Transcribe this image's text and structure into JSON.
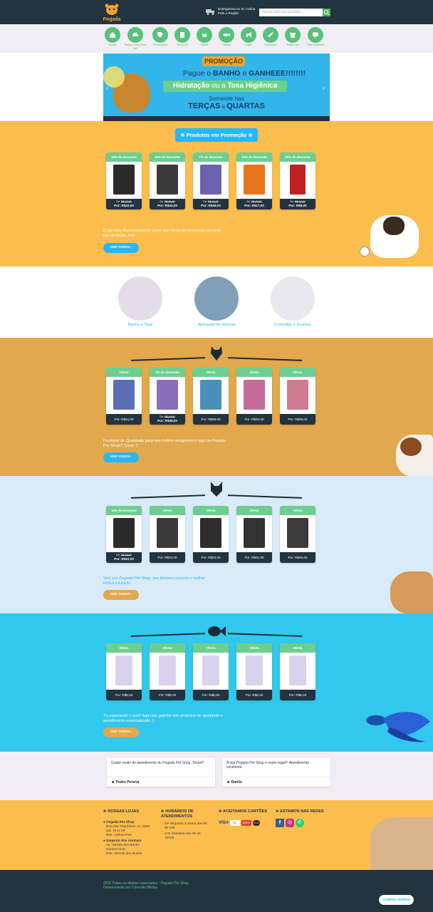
{
  "header": {
    "logo_text": "Pegada",
    "delivery_text": "Entregamos no St. Celina Park e Região",
    "search_placeholder": "buscar pelo seu produto...",
    "search_icon": "search-icon"
  },
  "nav": {
    "items": [
      {
        "label": "Home",
        "icon": "home-icon"
      },
      {
        "label": "Busca Leva sem pet",
        "icon": "car-icon"
      },
      {
        "label": "Promoções",
        "icon": "tag-icon"
      },
      {
        "label": "Serviços",
        "icon": "services-icon"
      },
      {
        "label": "Gatos",
        "icon": "cat-icon"
      },
      {
        "label": "Peixes",
        "icon": "fish-icon"
      },
      {
        "label": "Cães",
        "icon": "dog-icon"
      },
      {
        "label": "Pássaros",
        "icon": "bird-icon"
      },
      {
        "label": "Sobre nós",
        "icon": "store-icon"
      },
      {
        "label": "Fale Conosco",
        "icon": "chat-icon"
      }
    ]
  },
  "banner": {
    "badge": "PROMOÇÃO",
    "line1a": "Pague o ",
    "line1b": "BANHO",
    "line1c": " e ",
    "line1d": "GANHEEE!!!!!!!!",
    "line2a": "Hidratação",
    "line2b": " ou a ",
    "line2c": "Tosa Higiênica",
    "line3": "Somente nas",
    "line4a": "TERÇAS",
    "line4b": " e ",
    "line4c": "QUARTAS"
  },
  "promo": {
    "title": "Produtos em Promoção",
    "description": "O gambito Busca buscoOh Corre que há tendo promoção pra todo tipo de bicho, rsrs",
    "button": "VER TODOS",
    "products": [
      {
        "badge": "19% de desconto",
        "old": "De: R$ 27,00",
        "price": "Por: R$22,00",
        "color": "#2b2b2b"
      },
      {
        "badge": "12% de desconto",
        "old": "De: R$ 50,00",
        "price": "Por: R$44,00",
        "color": "#3a3a3a"
      },
      {
        "badge": "7% de desconto",
        "old": "De: R$ 42,00",
        "price": "Por: R$39,00",
        "color": "#6b62b0"
      },
      {
        "badge": "15% de desconto",
        "old": "De: R$ 20,00",
        "price": "Por: R$17,00",
        "color": "#e8741e"
      },
      {
        "badge": "10% de desconto",
        "old": "De: R$ 10,00",
        "price": "Por: R$9,00",
        "color": "#c02020"
      }
    ]
  },
  "services": [
    {
      "label": "Banho e Tosa"
    },
    {
      "label": "Aplicação de Vacinas"
    },
    {
      "label": "Consultas e Exames"
    }
  ],
  "dogs": {
    "description": "Produtos de Qualidade para seu melhor amiguinho é aqui na Pegada Pet Shop!!! Corre :)",
    "button": "VER TODOS",
    "products": [
      {
        "badge": "Oferta",
        "old": "",
        "price": "Por: R$41,00",
        "color": "#5b6fb5"
      },
      {
        "badge": "7% de desconto",
        "old": "De: R$ 42,00",
        "price": "Por: R$39,00",
        "color": "#8a6fb8"
      },
      {
        "badge": "Oferta",
        "old": "",
        "price": "Por: R$39,00",
        "color": "#4a8fb8"
      },
      {
        "badge": "Oferta",
        "old": "",
        "price": "Por: R$40,00",
        "color": "#c56b9a"
      },
      {
        "badge": "Oferta",
        "old": "",
        "price": "Por: R$39,00",
        "color": "#d07a8f"
      }
    ]
  },
  "cats": {
    "description": "Vem pro Pegada Pet Shop, seu bichano merece o melhor MIAUUUUUUU",
    "button": "VER TODOS",
    "products": [
      {
        "badge": "12% de desconto",
        "old": "De: R$ 25,00",
        "price": "Por: R$22,00",
        "color": "#2b2b2b"
      },
      {
        "badge": "Oferta",
        "old": "",
        "price": "Por: R$22,00",
        "color": "#3a3a3a"
      },
      {
        "badge": "Oferta",
        "old": "",
        "price": "Por: R$20,00",
        "color": "#2d2d2d"
      },
      {
        "badge": "Oferta",
        "old": "",
        "price": "Por: R$21,00",
        "color": "#333333"
      },
      {
        "badge": "Oferta",
        "old": "",
        "price": "Por: R$45,00",
        "color": "#3b3b3b"
      }
    ]
  },
  "fish": {
    "description": "Tá esperando o quê? Aqui seu galinho tem produtos de qualidade e atendimento especializado ;)",
    "button": "VER TODOS",
    "products": [
      {
        "badge": "Oferta",
        "old": "",
        "price": "Por: R$6,00",
        "color": "#e0dcf0"
      },
      {
        "badge": "Oferta",
        "old": "",
        "price": "Por: R$6,00",
        "color": "#e0dcf0"
      },
      {
        "badge": "Oferta",
        "old": "",
        "price": "Por: R$6,00",
        "color": "#e0dcf0"
      },
      {
        "badge": "Oferta",
        "old": "",
        "price": "Por: R$6,00",
        "color": "#e0dcf0"
      },
      {
        "badge": "Oferta",
        "old": "",
        "price": "Por: R$6,00",
        "color": "#e0dcf0"
      }
    ]
  },
  "testimonials": [
    {
      "text": "Gostei muito do atendimento do Pegada Pet Shop. Show!!!",
      "author": "Pedro Pereira"
    },
    {
      "text": "A loja Pegada Pet Shop é muito legal!!! Atendimento excelente.",
      "author": "Danilo"
    }
  ],
  "footer": {
    "stores_title": "NOSSAS LOJAS",
    "store1_name": "Pegada Pet Shop",
    "store1_addr1": "Rua das Orquídeas, N. 1808",
    "store1_addr2": "Qd. 10 Lt 29",
    "store1_addr3": "Res. Celina Park",
    "store2_name": "Emporio dos Animais",
    "store2_addr1": "Av. Vereda dos Buritis",
    "store2_addr2": "Número 515",
    "store2_addr3": "Res. Vereda dos Buritis",
    "hours_title": "HORÁRIOS DE ATENDIMENTOS",
    "hours1": "De Segunda a Sexta das 8h às 18h",
    "hours2": "Aos Sabados das 8h às 13h30",
    "cards_title": "ACEITAMOS CARTÕES",
    "cards": [
      "VISA",
      "MC",
      "AMEX",
      "ELO"
    ],
    "social_title": "ESTAMOS NAS REDES",
    "social": [
      "facebook-icon",
      "instagram-icon",
      "whatsapp-icon"
    ],
    "copyright1": "2020 Todos os direitos reservados - Pegada Pet Shop",
    "copyright2": "Desenvolvido por Conexão Mídias",
    "quick_buy": "COMPRA RÁPIDA"
  },
  "colors": {
    "dark": "#22343f",
    "green": "#6ccf8f",
    "blue": "#29b6f6",
    "orange": "#fbbd4d"
  }
}
